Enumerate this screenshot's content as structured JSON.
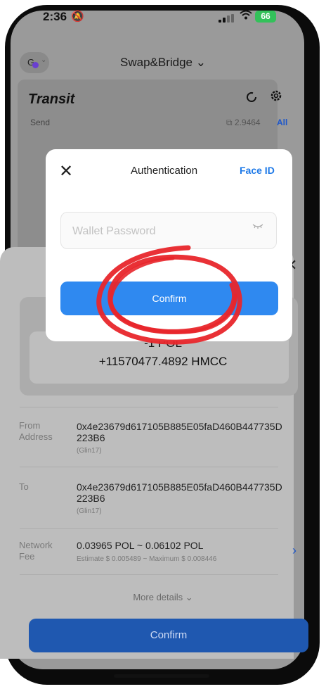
{
  "status_bar": {
    "time": "2:36",
    "battery": "66"
  },
  "header": {
    "title": "Swap&Bridge ⌄",
    "avatar_letter": "G"
  },
  "card": {
    "title": "Transit",
    "send_label": "Send",
    "balance": "2.9464",
    "all_label": "All"
  },
  "dialog": {
    "title": "Authentication",
    "face_id": "Face ID",
    "password_placeholder": "Wallet Password",
    "confirm_label": "Confirm"
  },
  "transaction": {
    "amount_out": "-1 POL",
    "amount_in": "+11570477.4892 HMCC",
    "from_label": "From Address",
    "from_address": "0x4e23679d617105B885E05faD460B447735D223B6",
    "from_name": "(Glin17)",
    "to_label": "To",
    "to_address": "0x4e23679d617105B885E05faD460B447735D223B6",
    "to_name": "(Glin17)",
    "fee_label": "Network Fee",
    "fee_value": "0.03965 POL ~ 0.06102 POL",
    "fee_estimate": "Estimate $ 0.005489 ~ Maximum $ 0.008446",
    "more_details": "More details ⌄",
    "confirm_label": "Confirm"
  },
  "colors": {
    "accent": "#2f89f0",
    "face_id": "#1f7ae8",
    "annotation": "#e8262b",
    "battery": "#33c15a"
  }
}
